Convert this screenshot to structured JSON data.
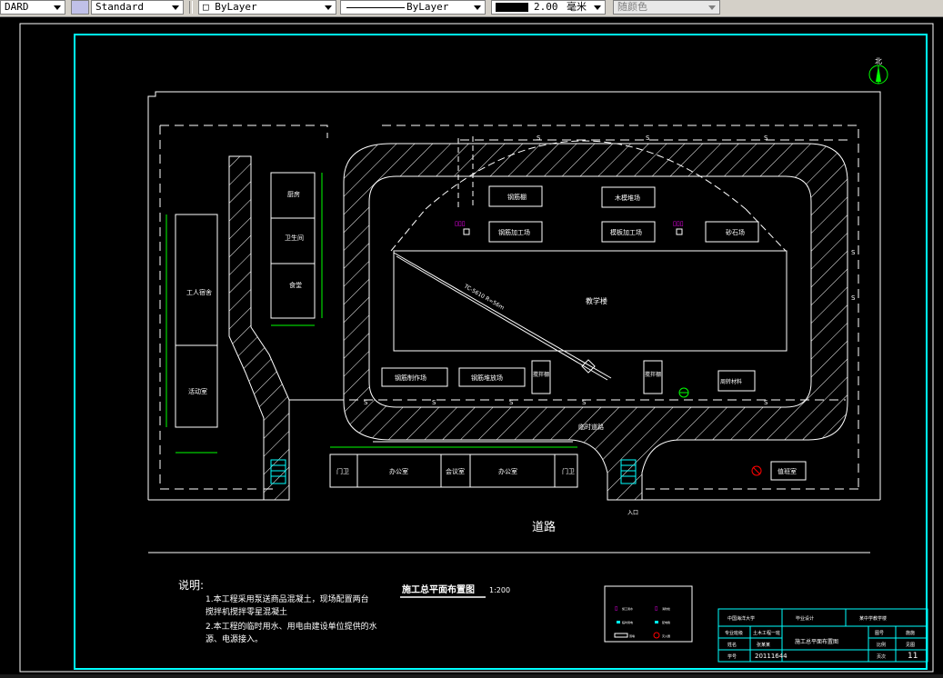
{
  "toolbar": {
    "text_style_partial": "DARD",
    "dim_style": "Standard",
    "layer_check": "□",
    "layer": "ByLayer",
    "linetype": "ByLayer",
    "lineweight_value": "2.00",
    "lineweight_unit": "毫米",
    "plot_style": "随颜色"
  },
  "drawing": {
    "north_label": "北",
    "buildings": {
      "kitchen": "厨房",
      "toilet": "卫生间",
      "dining": "食堂",
      "worker_dorm": "工人宿舍",
      "activity_room": "活动室",
      "steel_shed": "钢筋棚",
      "formwork_stack": "木模堆场",
      "steel_processing": "钢筋加工场",
      "formwork_processing": "模板加工场",
      "sand_stone": "砂石场",
      "teaching_building": "教学楼",
      "crane_label": "TC-5610 R=56m",
      "precast_yard_1": "钢筋制作场",
      "precast_yard_2": "钢筋堆放场",
      "mixer_1": "搅拌棚",
      "mixer_2": "搅拌棚",
      "turnover": "周转材料",
      "temp_road": "临时道路",
      "gate_left": "门卫",
      "office_1": "办公室",
      "reception": "会议室",
      "office_2": "办公室",
      "gate_right": "门卫",
      "guard_room": "值班室",
      "entrance": "入口",
      "road": "道路"
    },
    "notes": {
      "heading": "说明:",
      "line1": "1.本工程采用泵送商品混凝土，现场配置两台",
      "line2": "搅拌机搅拌零星混凝土",
      "line3": "2.本工程的临时用水、用电由建设单位提供的水",
      "line4": "源、电源接入。"
    },
    "title_main": "施工总平面布置图",
    "title_scale": "1:200",
    "legend": {
      "item1": "施工用水",
      "item2": "消防栓",
      "item3": "临时用电",
      "item4": "配电箱",
      "item5": "围墙",
      "item6": "灭火器"
    },
    "titleblock": {
      "school": "中国海洋大学",
      "dept": "毕业设计",
      "project": "某中学教学楼",
      "major_label": "专业班级",
      "major_value": "土木工程一班",
      "drawing_name": "施工总平面布置图",
      "drawing_no_label": "图号",
      "drawing_no": "施施",
      "name_label": "姓名",
      "name_value": "张某某",
      "scale_label": "比例",
      "scale_value": "见图",
      "id_label": "学号",
      "id_value": "20111644",
      "sheet_label": "页次",
      "sheet_value": "11"
    },
    "water_marker": "S"
  }
}
